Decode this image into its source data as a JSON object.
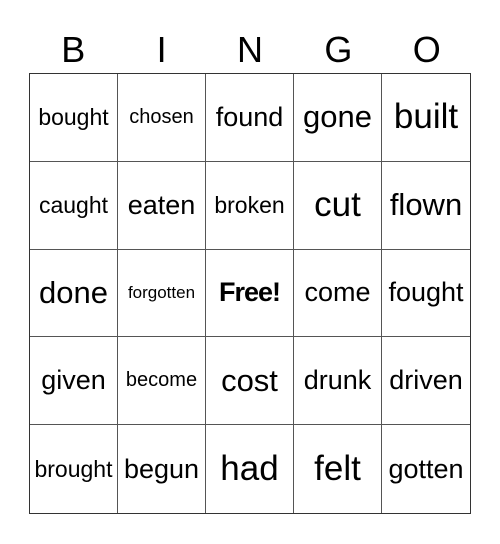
{
  "header": [
    "B",
    "I",
    "N",
    "G",
    "O"
  ],
  "cells": [
    {
      "text": "bought",
      "size": "md"
    },
    {
      "text": "chosen",
      "size": "sm"
    },
    {
      "text": "found",
      "size": "lg"
    },
    {
      "text": "gone",
      "size": "xl"
    },
    {
      "text": "built",
      "size": "xxl"
    },
    {
      "text": "caught",
      "size": "md"
    },
    {
      "text": "eaten",
      "size": "lg"
    },
    {
      "text": "broken",
      "size": "md"
    },
    {
      "text": "cut",
      "size": "xxl"
    },
    {
      "text": "flown",
      "size": "xl"
    },
    {
      "text": "done",
      "size": "xl"
    },
    {
      "text": "forgotten",
      "size": "xs"
    },
    {
      "text": "Free!",
      "size": "free"
    },
    {
      "text": "come",
      "size": "lg"
    },
    {
      "text": "fought",
      "size": "lg"
    },
    {
      "text": "given",
      "size": "lg"
    },
    {
      "text": "become",
      "size": "sm"
    },
    {
      "text": "cost",
      "size": "xl"
    },
    {
      "text": "drunk",
      "size": "lg"
    },
    {
      "text": "driven",
      "size": "lg"
    },
    {
      "text": "brought",
      "size": "md"
    },
    {
      "text": "begun",
      "size": "lg"
    },
    {
      "text": "had",
      "size": "xxl"
    },
    {
      "text": "felt",
      "size": "xxl"
    },
    {
      "text": "gotten",
      "size": "lg"
    }
  ]
}
